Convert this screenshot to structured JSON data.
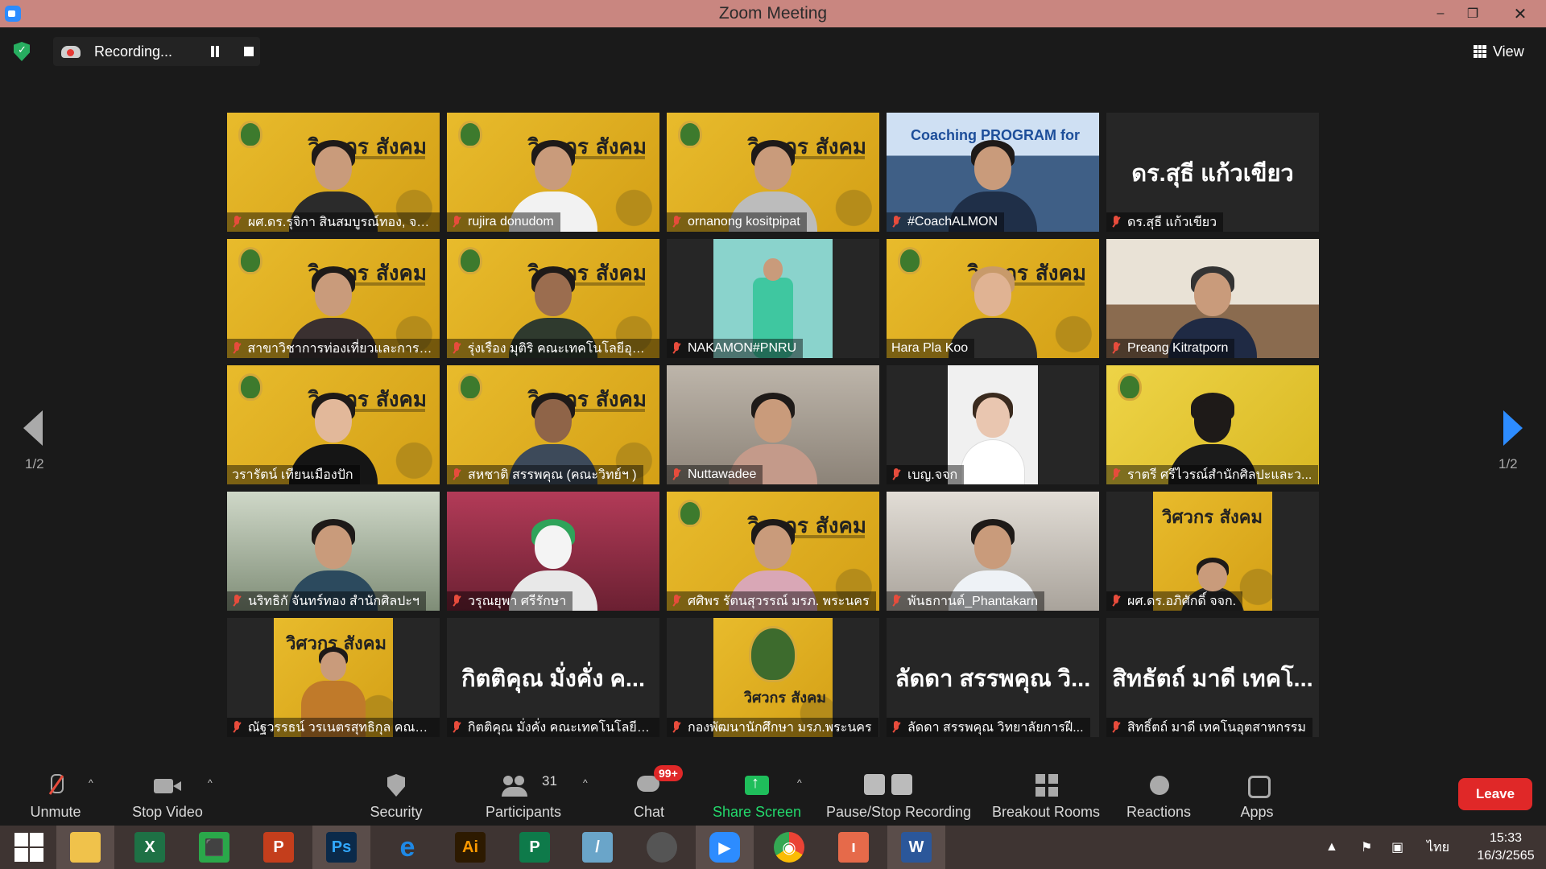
{
  "window": {
    "title": "Zoom Meeting",
    "minimize": "–",
    "maximize": "❐",
    "close": "✕"
  },
  "topbar": {
    "recording_label": "Recording...",
    "view_label": "View"
  },
  "paging": {
    "left": "1/2",
    "right": "1/2"
  },
  "tiles": [
    {
      "name": "ผศ.ดร.รุจิกา สินสมบูรณ์ทอง, จจ..."
    },
    {
      "name": "rujira donudom"
    },
    {
      "name": "ornanong kositpipat"
    },
    {
      "name": "#CoachALMON",
      "poster_text": "Coaching PROGRAM for"
    },
    {
      "name": "ดร.สุธี แก้วเขียว",
      "big_name": "ดร.สุธี แก้วเขียว"
    },
    {
      "name": "สาขาวิชาการท่องเที่ยวและการโร..."
    },
    {
      "name": "รุ่งเรือง มุติริ คณะเทคโนโลยีอุตส..."
    },
    {
      "name": "NAKAMON#PNRU"
    },
    {
      "name": "Hara Pla Koo"
    },
    {
      "name": "Preang Kitratporn"
    },
    {
      "name": "วรารัตน์ เทียนเมืองปัก"
    },
    {
      "name": "สหชาติ สรรพคุณ (คณะวิทย์ฯ )"
    },
    {
      "name": "Nuttawadee"
    },
    {
      "name": "เบญ.จจก"
    },
    {
      "name": "ราตรี  ศรีไวรณ์สำนักศิลปะและว..."
    },
    {
      "name": "นริทธิกั จันทร์ทอง สำนักศิลปะฯ"
    },
    {
      "name": "วรุณยุพา ศรีรักษา"
    },
    {
      "name": "ศศิพร รัตนสุวรรณ์ มรภ. พระนคร"
    },
    {
      "name": "พันธกานต์_Phantakarn"
    },
    {
      "name": "ผศ.ดร.อภิศักดิ์ จจก."
    },
    {
      "name": "ณัฐวรรธน์ วรเนตรสุทธิกุล คณะเ..."
    },
    {
      "name": "กิตติคุณ  มั่งคั่ง คณะเทคโนโลยีอุ...",
      "big_name": "กิตติคุณ  มั่งคั่ง ค..."
    },
    {
      "name": "กองพัฒนานักศึกษา มรภ.พระนคร"
    },
    {
      "name": "ลัดดา สรรพคุณ วิทยาลัยการฝี...",
      "big_name": "ลัดดา สรรพคุณ วิ..."
    },
    {
      "name": "สิทธิ์ตถ์ มาดี เทคโนอุตสาหกรรม",
      "big_name": "สิทธัตถ์ มาดี เทคโ..."
    }
  ],
  "poster": {
    "wordmark": "วิศวกร สังคม"
  },
  "toolbar": {
    "unmute": "Unmute",
    "stop_video": "Stop Video",
    "security": "Security",
    "participants": "Participants",
    "participants_count": "31",
    "chat": "Chat",
    "chat_badge": "99+",
    "share_screen": "Share Screen",
    "pause_stop": "Pause/Stop Recording",
    "breakout": "Breakout Rooms",
    "reactions": "Reactions",
    "apps": "Apps",
    "leave": "Leave",
    "caret": "^"
  },
  "taskbar": {
    "apps": [
      {
        "label": "",
        "color": "#f0c24b"
      },
      {
        "label": "X",
        "color": "#1e7145"
      },
      {
        "label": "⬛",
        "color": "#2aa84a"
      },
      {
        "label": "P",
        "color": "#c43e1c"
      },
      {
        "label": "Ps",
        "color": "#0b2a4a"
      },
      {
        "label": "e",
        "color": "#1e88e5"
      },
      {
        "label": "Ai",
        "color": "#2d1a00"
      },
      {
        "label": "P",
        "color": "#0e7a4a"
      },
      {
        "label": "/",
        "color": "#6aa5c9"
      },
      {
        "label": "",
        "color": "#555"
      },
      {
        "label": "▶",
        "color": "#2d8cff"
      },
      {
        "label": "◉",
        "color": "#e8a317"
      },
      {
        "label": "ı",
        "color": "#e66a4a"
      },
      {
        "label": "W",
        "color": "#2b579a"
      }
    ],
    "lang": "ไทย",
    "time": "15:33",
    "date": "16/3/2565"
  },
  "colors": {
    "accent": "#2d8cff",
    "leave": "#e02828",
    "share": "#23d96c",
    "titlebar": "#c98680"
  }
}
